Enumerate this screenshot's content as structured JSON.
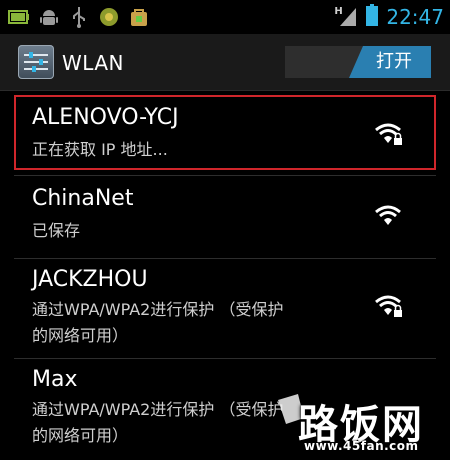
{
  "status_bar": {
    "time": "22:47",
    "signal_type": "H",
    "left_icons": [
      "battery-status-icon",
      "android-debug-icon",
      "usb-icon",
      "app-notification-icon",
      "market-icon"
    ]
  },
  "action_bar": {
    "title": "WLAN",
    "toggle_label": "打开"
  },
  "networks": [
    {
      "ssid": "ALENOVO-YCJ",
      "status": "正在获取 IP 地址...",
      "secured": true
    },
    {
      "ssid": "ChinaNet",
      "status": "已保存",
      "secured": false
    },
    {
      "ssid": "JACKZHOU",
      "status_lines": [
        "通过WPA/WPA2进行保护 （受保护",
        "的网络可用）"
      ],
      "secured": true
    },
    {
      "ssid": "Max",
      "status_lines": [
        "通过WPA/WPA2进行保护 （受保护",
        "的网络可用）"
      ],
      "secured": true
    }
  ],
  "watermark": {
    "brand": "路饭网",
    "url": "www.45fan.com"
  },
  "colors": {
    "accent": "#33b5e5",
    "toggle_on": "#2a7fb1",
    "highlight_border": "#d0262b"
  }
}
